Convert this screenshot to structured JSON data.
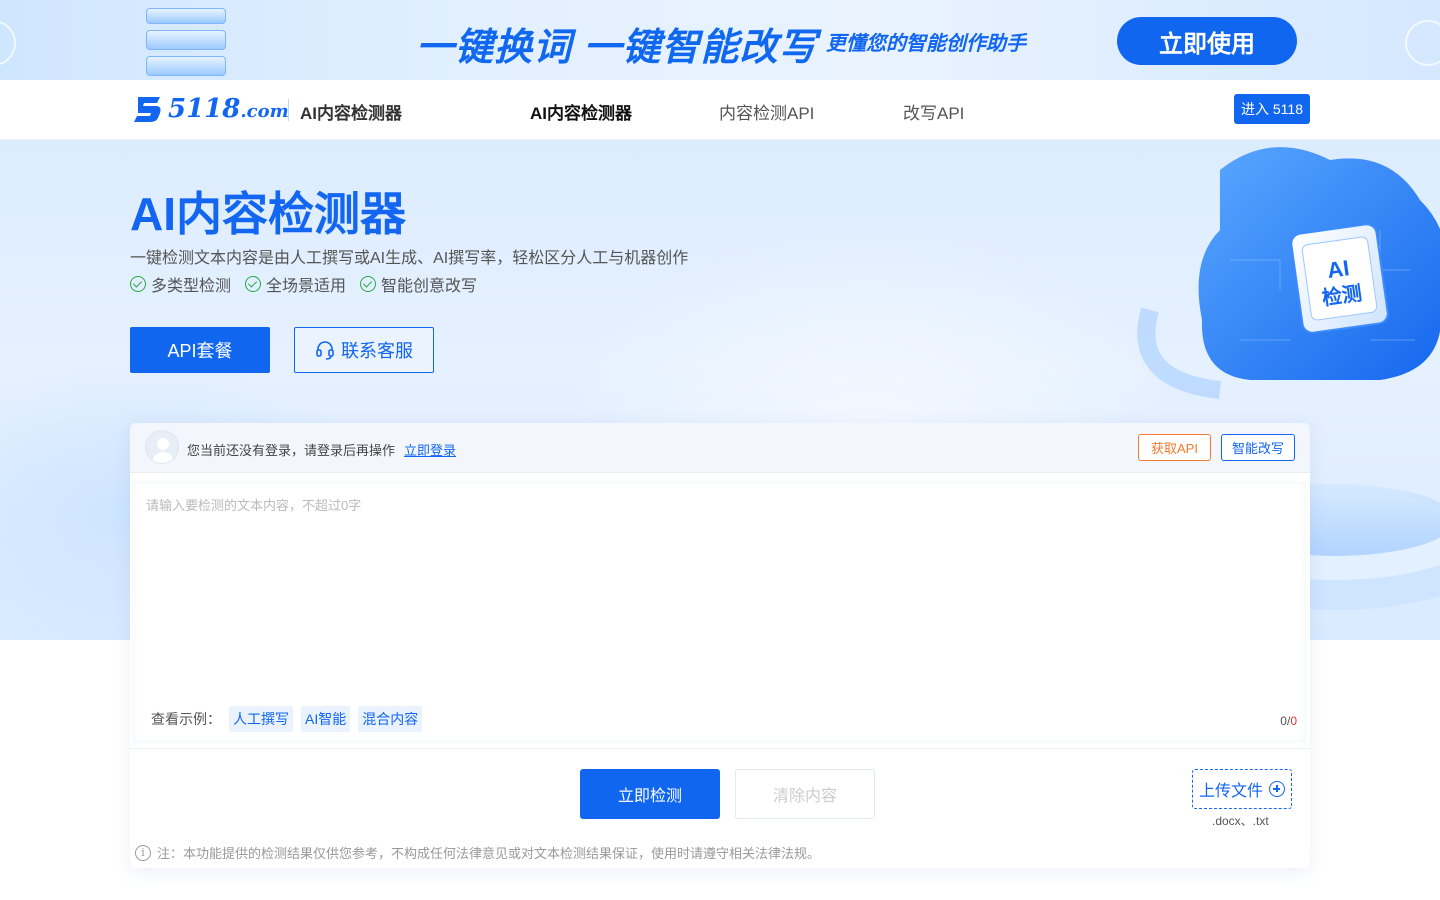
{
  "banner": {
    "title": "一键换词 一键智能改写",
    "subtitle": "更懂您的智能创作助手",
    "cta": "立即使用"
  },
  "nav": {
    "logo_text": "5118",
    "logo_suffix": ".com",
    "product_name": "AI内容检测器",
    "links": [
      "AI内容检测器",
      "内容检测API",
      "改写API"
    ],
    "active_index": 0,
    "enter_button": "进入 5118"
  },
  "hero": {
    "title": "AI内容检测器",
    "description": "一键检测文本内容是由人工撰写或AI生成、AI撰写率，轻松区分人工与机器创作",
    "features": [
      "多类型检测",
      "全场景适用",
      "智能创意改写"
    ],
    "api_button": "API套餐",
    "service_button": "联系客服",
    "illustration_text": [
      "AI",
      "检测"
    ]
  },
  "detector": {
    "login_message": "您当前还没有登录，请登录后再操作",
    "login_link": "立即登录",
    "get_api_button": "获取API",
    "smart_rewrite_button": "智能改写",
    "textarea_placeholder": "请输入要检测的文本内容，不超过0字",
    "textarea_value": "",
    "examples_label": "查看示例：",
    "examples": [
      "人工撰写",
      "AI智能",
      "混合内容"
    ],
    "counter_current": "0",
    "counter_sep": "/",
    "counter_max": "0",
    "detect_button": "立即检测",
    "clear_button": "清除内容",
    "upload_button": "上传文件",
    "upload_types": ".docx、.txt"
  },
  "notice": {
    "icon": "i",
    "text": "注：本功能提供的检测结果仅供您参考，不构成任何法律意见或对文本检测结果保证，使用时请遵守相关法律法规。"
  },
  "colors": {
    "primary": "#1166f0",
    "warning": "#f07b2f",
    "success": "#27a845",
    "hero_bg": "#dcecff"
  }
}
